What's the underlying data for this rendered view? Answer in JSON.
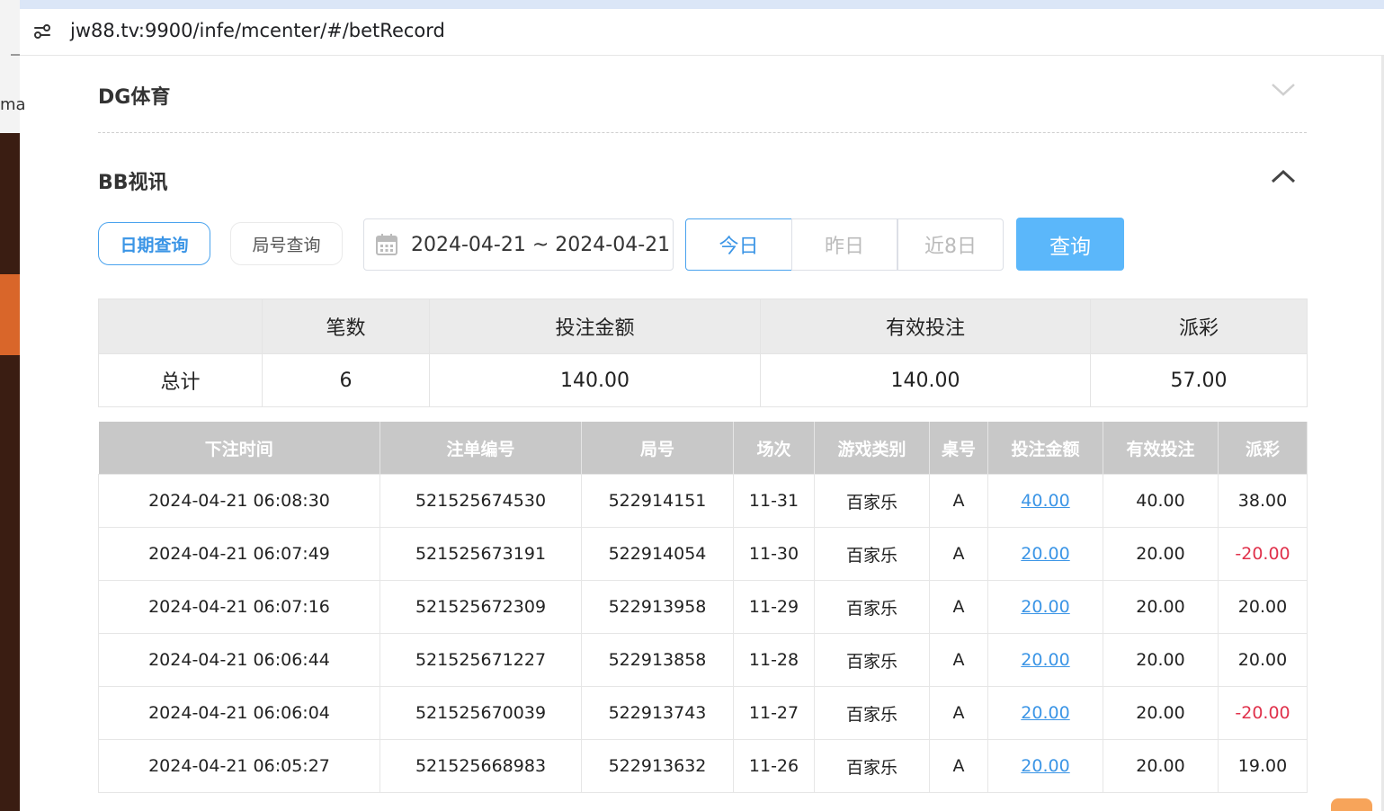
{
  "browser": {
    "url": "jw88.tv:9900/infe/mcenter/#/betRecord",
    "left_fragment": "ma"
  },
  "sections": {
    "dg_title": "DG体育",
    "bb_title": "BB视讯"
  },
  "filters": {
    "tab_date": "日期查询",
    "tab_round": "局号查询",
    "date_range": "2024-04-21 ~ 2024-04-21",
    "quick_today": "今日",
    "quick_yesterday": "昨日",
    "quick_8days": "近8日",
    "query_button": "查询"
  },
  "summary": {
    "headers": [
      "",
      "笔数",
      "投注金额",
      "有效投注",
      "派彩"
    ],
    "row": [
      "总计",
      "6",
      "140.00",
      "140.00",
      "57.00"
    ]
  },
  "records": {
    "headers": [
      "下注时间",
      "注单编号",
      "局号",
      "场次",
      "游戏类别",
      "桌号",
      "投注金额",
      "有效投注",
      "派彩"
    ],
    "rows": [
      [
        "2024-04-21 06:08:30",
        "521525674530",
        "522914151",
        "11-31",
        "百家乐",
        "A",
        "40.00",
        "40.00",
        "38.00"
      ],
      [
        "2024-04-21 06:07:49",
        "521525673191",
        "522914054",
        "11-30",
        "百家乐",
        "A",
        "20.00",
        "20.00",
        "-20.00"
      ],
      [
        "2024-04-21 06:07:16",
        "521525672309",
        "522913958",
        "11-29",
        "百家乐",
        "A",
        "20.00",
        "20.00",
        "20.00"
      ],
      [
        "2024-04-21 06:06:44",
        "521525671227",
        "522913858",
        "11-28",
        "百家乐",
        "A",
        "20.00",
        "20.00",
        "20.00"
      ],
      [
        "2024-04-21 06:06:04",
        "521525670039",
        "522913743",
        "11-27",
        "百家乐",
        "A",
        "20.00",
        "20.00",
        "-20.00"
      ],
      [
        "2024-04-21 06:05:27",
        "521525668983",
        "522913632",
        "11-26",
        "百家乐",
        "A",
        "20.00",
        "20.00",
        "19.00"
      ]
    ]
  },
  "colors": {
    "accent": "#3b95e6",
    "query_button": "#5bb7fa",
    "negative": "#e0314b",
    "header_gray": "#c8c8c8"
  }
}
